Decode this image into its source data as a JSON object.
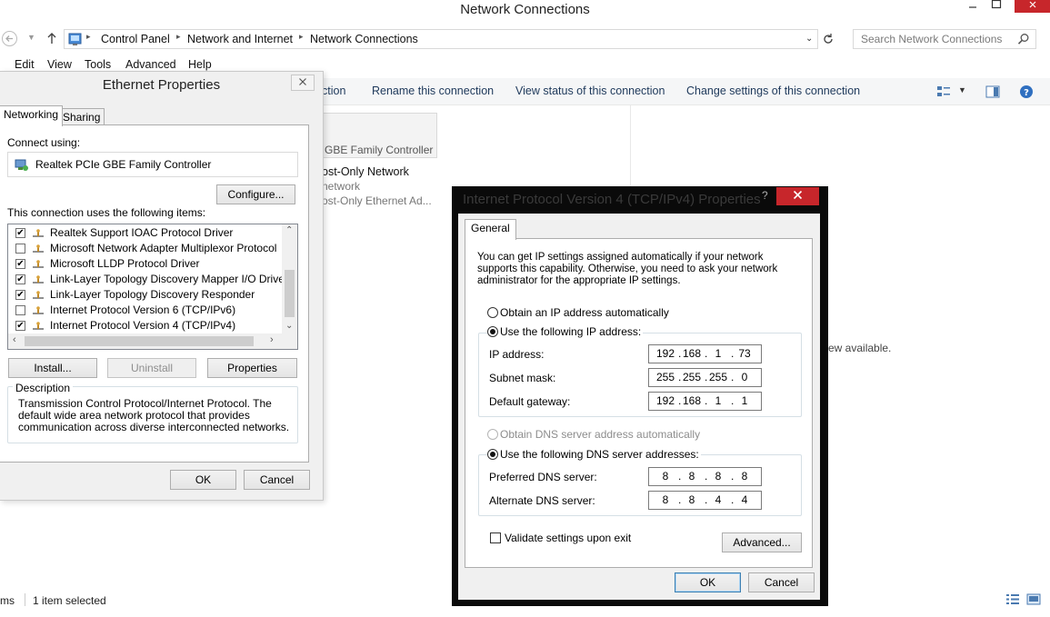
{
  "explorer": {
    "title": "Network Connections",
    "breadcrumb": [
      "Control Panel",
      "Network and Internet",
      "Network Connections"
    ],
    "search_placeholder": "Search Network Connections",
    "menu": [
      "Edit",
      "View",
      "Tools",
      "Advanced",
      "Help"
    ],
    "commands": [
      "ction",
      "Rename this connection",
      "View status of this connection",
      "Change settings of this connection"
    ],
    "adapter": {
      "line1": "GBE Family Controller",
      "name": "ost-Only Network",
      "line2": "network",
      "line3": "ost-Only Ethernet Ad..."
    },
    "right_text": "ew available.",
    "status_left": "ms",
    "status_selected": "1 item selected"
  },
  "ethernet": {
    "title": "Ethernet Properties",
    "tabs": [
      "Networking",
      "Sharing"
    ],
    "connect_using_label": "Connect using:",
    "adapter_name": "Realtek PCIe GBE Family Controller",
    "configure_label": "Configure...",
    "items_label": "This connection uses the following items:",
    "items": [
      {
        "label": "Realtek Support IOAC Protocol Driver",
        "checked": true
      },
      {
        "label": "Microsoft Network Adapter Multiplexor Protocol",
        "checked": false
      },
      {
        "label": "Microsoft LLDP Protocol Driver",
        "checked": true
      },
      {
        "label": "Link-Layer Topology Discovery Mapper I/O Driver",
        "checked": true
      },
      {
        "label": "Link-Layer Topology Discovery Responder",
        "checked": true
      },
      {
        "label": "Internet Protocol Version 6 (TCP/IPv6)",
        "checked": false
      },
      {
        "label": "Internet Protocol Version 4 (TCP/IPv4)",
        "checked": true
      }
    ],
    "install_label": "Install...",
    "uninstall_label": "Uninstall",
    "properties_label": "Properties",
    "description_legend": "Description",
    "description_text": "Transmission Control Protocol/Internet Protocol. The default wide area network protocol that provides communication across diverse interconnected networks.",
    "ok_label": "OK",
    "cancel_label": "Cancel"
  },
  "ipv4": {
    "title": "Internet Protocol Version 4 (TCP/IPv4) Properties",
    "tab": "General",
    "intro": "You can get IP settings assigned automatically if your network supports this capability. Otherwise, you need to ask your network administrator for the appropriate IP settings.",
    "obtain_ip_auto": "Obtain an IP address automatically",
    "use_following_ip": "Use the following IP address:",
    "ip_label": "IP address:",
    "ip_value": [
      "192",
      "168",
      "1",
      "73"
    ],
    "subnet_label": "Subnet mask:",
    "subnet_value": [
      "255",
      "255",
      "255",
      "0"
    ],
    "gateway_label": "Default gateway:",
    "gateway_value": [
      "192",
      "168",
      "1",
      "1"
    ],
    "obtain_dns_auto": "Obtain DNS server address automatically",
    "use_following_dns": "Use the following DNS server addresses:",
    "pref_dns_label": "Preferred DNS server:",
    "pref_dns_value": [
      "8",
      "8",
      "8",
      "8"
    ],
    "alt_dns_label": "Alternate DNS server:",
    "alt_dns_value": [
      "8",
      "8",
      "4",
      "4"
    ],
    "validate_label": "Validate settings upon exit",
    "advanced_label": "Advanced...",
    "ok_label": "OK",
    "cancel_label": "Cancel",
    "help_glyph": "?"
  },
  "colors": {
    "accent": "#1e395b",
    "close_red": "#c7262b",
    "dialog_bg": "#f0f0f0"
  }
}
